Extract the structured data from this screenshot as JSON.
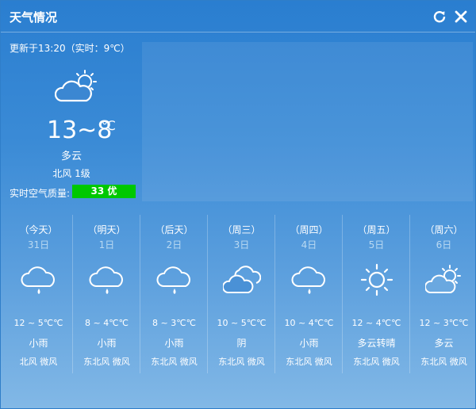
{
  "window": {
    "title": "天气情况"
  },
  "current": {
    "updated": "更新于13:20（实时：9℃）",
    "icon": "partly-cloudy-icon",
    "temp_range": "13~8",
    "temp_unit": "℃",
    "condition": "多云",
    "wind": "北风 1级",
    "aqi_label": "实时空气质量:",
    "aqi_value": "33 优",
    "aqi_color": "#00c800"
  },
  "forecast": [
    {
      "weekday": "（今天）",
      "date": "31日",
      "icon": "rain-icon",
      "temp": "12 ~ 5℃℃",
      "condition": "小雨",
      "wind": "北风 微风"
    },
    {
      "weekday": "（明天）",
      "date": "1日",
      "icon": "rain-icon",
      "temp": "8 ~ 4℃℃",
      "condition": "小雨",
      "wind": "东北风 微风"
    },
    {
      "weekday": "（后天）",
      "date": "2日",
      "icon": "rain-icon",
      "temp": "8 ~ 3℃℃",
      "condition": "小雨",
      "wind": "东北风 微风"
    },
    {
      "weekday": "（周三）",
      "date": "3日",
      "icon": "overcast-icon",
      "temp": "10 ~ 5℃℃",
      "condition": "阴",
      "wind": "东北风 微风"
    },
    {
      "weekday": "（周四）",
      "date": "4日",
      "icon": "rain-icon",
      "temp": "10 ~ 4℃℃",
      "condition": "小雨",
      "wind": "东北风 微风"
    },
    {
      "weekday": "（周五）",
      "date": "5日",
      "icon": "sun-icon",
      "temp": "12 ~ 4℃℃",
      "condition": "多云转晴",
      "wind": "东北风 微风"
    },
    {
      "weekday": "（周六）",
      "date": "6日",
      "icon": "partly-cloudy-icon",
      "temp": "12 ~ 3℃℃",
      "condition": "多云",
      "wind": "东北风 微风"
    }
  ]
}
